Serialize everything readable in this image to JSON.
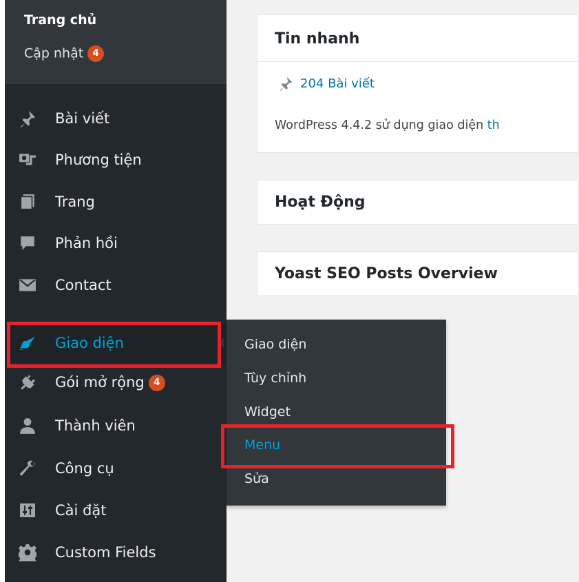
{
  "sidebar": {
    "home": {
      "title": "Trang chủ",
      "update_label": "Cập nhật",
      "update_badge": "4"
    },
    "items": [
      {
        "label": "Bài viết",
        "icon": "pushpin-icon"
      },
      {
        "label": "Phương tiện",
        "icon": "media-icon"
      },
      {
        "label": "Trang",
        "icon": "pages-icon"
      },
      {
        "label": "Phản hồi",
        "icon": "comment-icon"
      },
      {
        "label": "Contact",
        "icon": "envelope-icon"
      },
      {
        "label": "Giao diện",
        "icon": "appearance-brush-icon",
        "active": true
      },
      {
        "label": "Gói mở rộng",
        "icon": "plugin-icon",
        "badge": "4"
      },
      {
        "label": "Thành viên",
        "icon": "user-icon"
      },
      {
        "label": "Công cụ",
        "icon": "wrench-icon"
      },
      {
        "label": "Cài đặt",
        "icon": "settings-sliders-icon"
      },
      {
        "label": "Custom Fields",
        "icon": "gear-icon"
      }
    ]
  },
  "flyout": {
    "items": [
      {
        "label": "Giao diện"
      },
      {
        "label": "Tùy chỉnh"
      },
      {
        "label": "Widget"
      },
      {
        "label": "Menu",
        "active": true
      },
      {
        "label": "Sửa"
      }
    ]
  },
  "dashboard": {
    "at_a_glance": {
      "title": "Tin nhanh",
      "posts_link": "204 Bài viết",
      "version_text": "WordPress 4.4.2 sử dụng giao diện ",
      "theme_link_fragment": "th"
    },
    "activity": {
      "title": "Hoạt Động"
    },
    "yoast": {
      "title": "Yoast SEO Posts Overview"
    }
  },
  "colors": {
    "sidebar_bg": "#23282d",
    "submenu_bg": "#32373c",
    "accent": "#00a0d2",
    "badge": "#d54e21",
    "highlight_box": "#e8212b",
    "link": "#0073aa"
  }
}
